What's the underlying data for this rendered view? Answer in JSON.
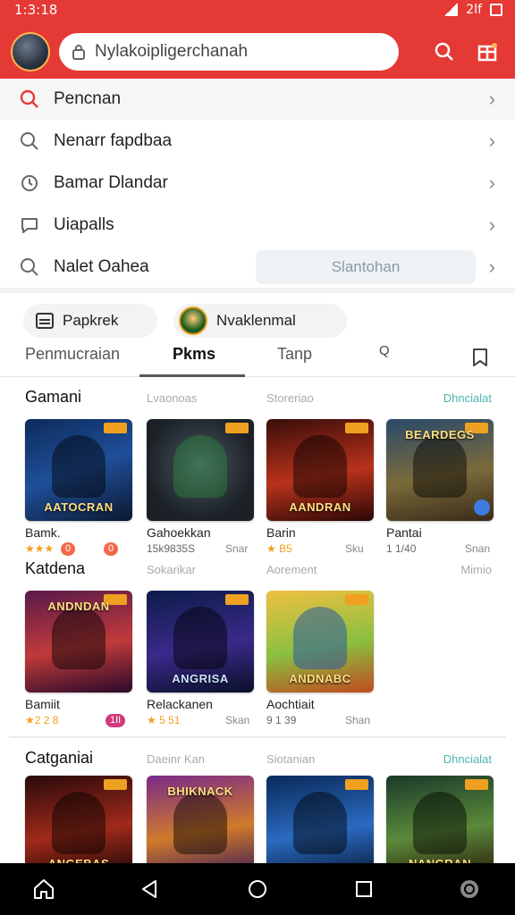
{
  "status": {
    "time": "1:3:18",
    "extra": "2lf"
  },
  "search": {
    "value": "Nylakoipligerchanah"
  },
  "suggestions": [
    {
      "label": "Pencnan",
      "icon": "search-icon"
    },
    {
      "label": "Nenarr fapdbaa",
      "icon": "search-icon"
    },
    {
      "label": "Bamar Dlandar",
      "icon": "history-icon"
    },
    {
      "label": "Uiapalls",
      "icon": "chat-icon"
    },
    {
      "label": "Nalet Oahea",
      "icon": "search-icon",
      "button": "Slantohan"
    }
  ],
  "chips": [
    {
      "label": "Papkrek"
    },
    {
      "label": "Nvaklenmal"
    }
  ],
  "tabs": [
    {
      "label": "Penmucraian"
    },
    {
      "label": "Pkms"
    },
    {
      "label": "Tanp"
    }
  ],
  "tab_icon_text": "Q",
  "sections": [
    {
      "title": "Gamani",
      "col1": "Lvaonoas",
      "col2": "Storeriao",
      "more": "Dhncialat",
      "cards": [
        {
          "name": "Bamk.",
          "rating": "★★★",
          "pill1": "0",
          "pill2": "0",
          "stat": "",
          "thumb_title": "AATOCRAN"
        },
        {
          "name": "Gahoekkan",
          "rating": "",
          "stat": "Snar",
          "meta": "15k9835S",
          "thumb_title": ""
        },
        {
          "name": "Barin",
          "rating": "★ B5",
          "stat": "Sku",
          "thumb_title": "AANDRAN"
        },
        {
          "name": "Pantai",
          "rating": "1 1/40",
          "stat": "Snan",
          "thumb_title": "BEARDEGS"
        }
      ]
    },
    {
      "title": "Katdena",
      "col1": "Sokarikar",
      "col2": "Aorement",
      "more": "Mimio",
      "cards": [
        {
          "name": "Bamiit",
          "rating": "★2 2 8",
          "pill2": "1II",
          "stat": "",
          "thumb_title": "ANDNDAN"
        },
        {
          "name": "Relackanen",
          "rating": "★ 5 51",
          "stat": "Skan",
          "thumb_title": "ANGRISA"
        },
        {
          "name": "Aochtiait",
          "rating": "9 1 39",
          "stat": "Shan",
          "thumb_title": "ANDNABC"
        }
      ]
    },
    {
      "title": "Catganiai",
      "col1": "Daeinr Kan",
      "col2": "Siotanian",
      "more": "Dhncialat",
      "cards": [
        {
          "name": "",
          "thumb_title": "ANGEBAS"
        },
        {
          "name": "",
          "thumb_title": "BHIKNACK"
        },
        {
          "name": "",
          "thumb_title": ""
        },
        {
          "name": "",
          "thumb_title": "NANGRAN"
        }
      ]
    }
  ],
  "colors": {
    "brand": "#e53935",
    "accent": "#4db6ac",
    "star": "#f0a020"
  }
}
